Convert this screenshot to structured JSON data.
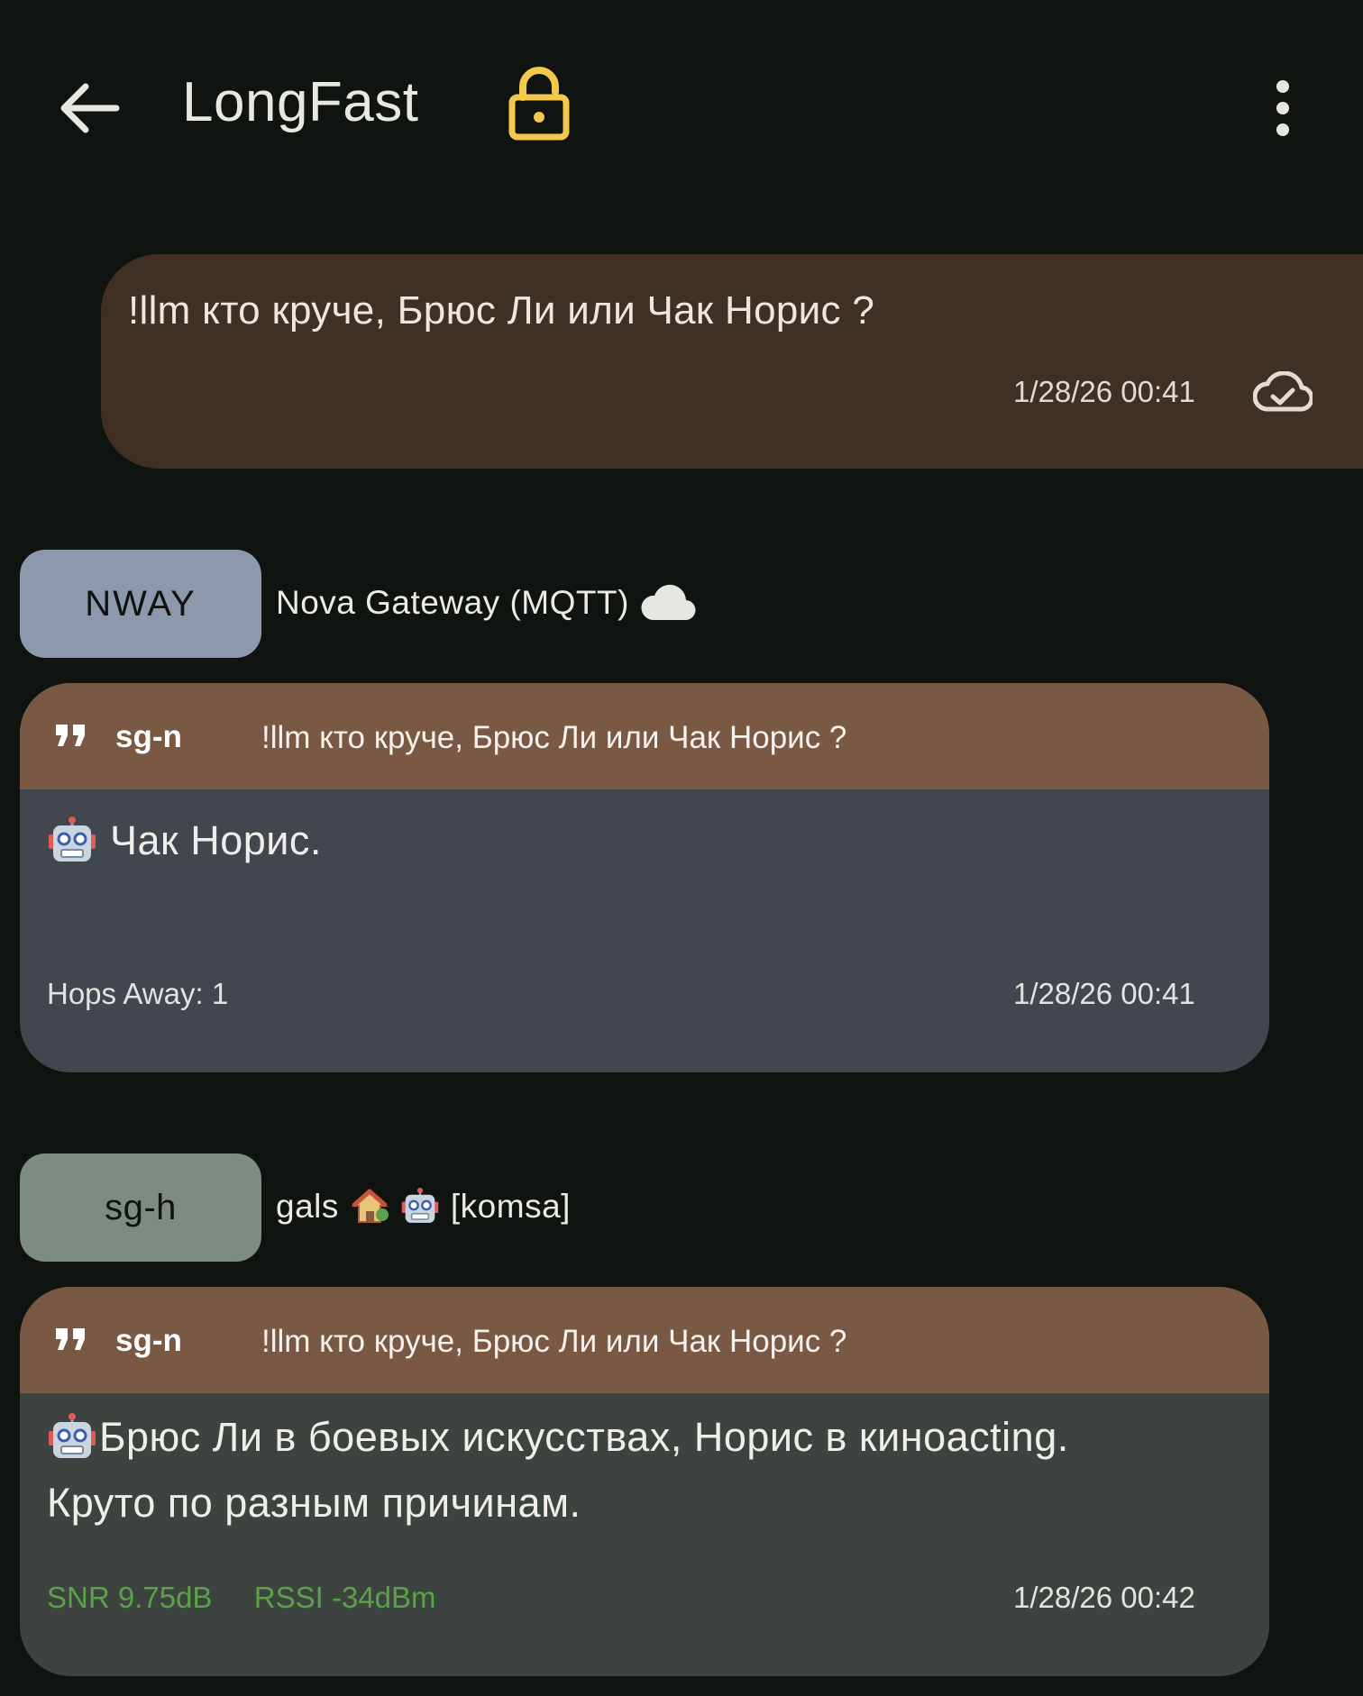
{
  "header": {
    "title": "LongFast",
    "back_icon": "arrow-left-icon",
    "lock_icon": "lock-open-icon",
    "menu_icon": "more-vertical-icon",
    "lock_color": "#f2c94c"
  },
  "own_message": {
    "text": "!llm кто круче, Брюс Ли или Чак Норис ?",
    "time": "1/28/26 00:41",
    "status_icon": "cloud-check-icon"
  },
  "messages": [
    {
      "sender_short": "NWAY",
      "sender_long": "Nova Gateway (MQTT)",
      "sender_icon": "cloud-icon",
      "quote_user": "sg-n",
      "quote_text": "!llm кто круче, Брюс Ли или Чак Норис ?",
      "text": "Чак Норис.",
      "hops": "Hops Away: 1",
      "time": "1/28/26 00:41"
    },
    {
      "sender_short": "sg-h",
      "sender_long": "gals",
      "sender_tag": "[komsa]",
      "quote_user": "sg-n",
      "quote_text": "!llm кто круче, Брюс Ли или Чак Норис ?",
      "text_line1": "Брюс Ли в боевых искусствах, Норис в киноacting.",
      "text_line2": "Круто по разным причинам.",
      "snr": "SNR 9.75dB",
      "rssi": "RSSI -34dBm",
      "time": "1/28/26 00:42"
    }
  ],
  "colors": {
    "background": "#0f1411",
    "own_bubble": "#3f3023",
    "quote_bar": "#7a5944",
    "chip_nway": "#8e98ac",
    "chip_sgh": "#7e8b80",
    "signal_green": "#5aa14a"
  }
}
